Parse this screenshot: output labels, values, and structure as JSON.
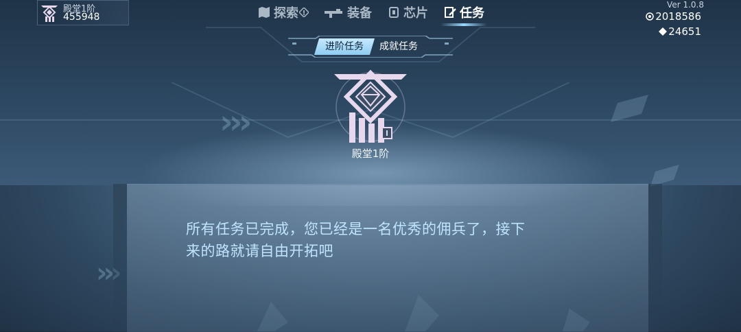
{
  "player": {
    "rank": "殿堂1阶",
    "score": "455948"
  },
  "nav": {
    "items": [
      {
        "label": "探索",
        "icon": "map-icon",
        "badge": "!"
      },
      {
        "label": "装备",
        "icon": "rifle-icon"
      },
      {
        "label": "芯片",
        "icon": "chip-icon"
      },
      {
        "label": "任务",
        "icon": "quest-icon",
        "active": true
      }
    ]
  },
  "version": "Ver 1.0.8",
  "currencies": [
    {
      "icon": "coin-icon",
      "value": "2018586"
    },
    {
      "icon": "diamond-icon",
      "value": "24651"
    }
  ],
  "subtabs": [
    {
      "label": "进阶任务",
      "active": true
    },
    {
      "label": "成就任务",
      "active": false
    }
  ],
  "emblem": {
    "name": "殿堂1阶",
    "icon": "hall-rank-emblem-icon"
  },
  "message": {
    "line1": "所有任务已完成，您已经是一名优秀的佣兵了，接下",
    "line2": "来的路就请自由开拓吧"
  },
  "colors": {
    "accent": "#9ad8ff",
    "message_text": "#bfe4ff",
    "emblem": "#e8d8ee"
  }
}
